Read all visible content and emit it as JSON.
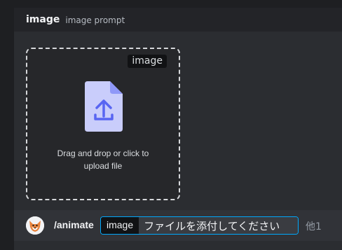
{
  "header": {
    "title": "image",
    "subtitle": "image prompt"
  },
  "dropzone": {
    "badge": "image",
    "line1": "Drag and drop or click to",
    "line2": "upload file",
    "icon": "upload-file-icon"
  },
  "command_bar": {
    "avatar_icon": "fox-avatar-icon",
    "command": "/animate",
    "option_name": "image",
    "option_value": "ファイルを添付してください",
    "more_label": "他1"
  },
  "colors": {
    "accent_border": "#00a8fc",
    "file_icon": "#c9cdfb",
    "file_fold": "#8f98f8",
    "upload_arrow": "#5865f2"
  }
}
